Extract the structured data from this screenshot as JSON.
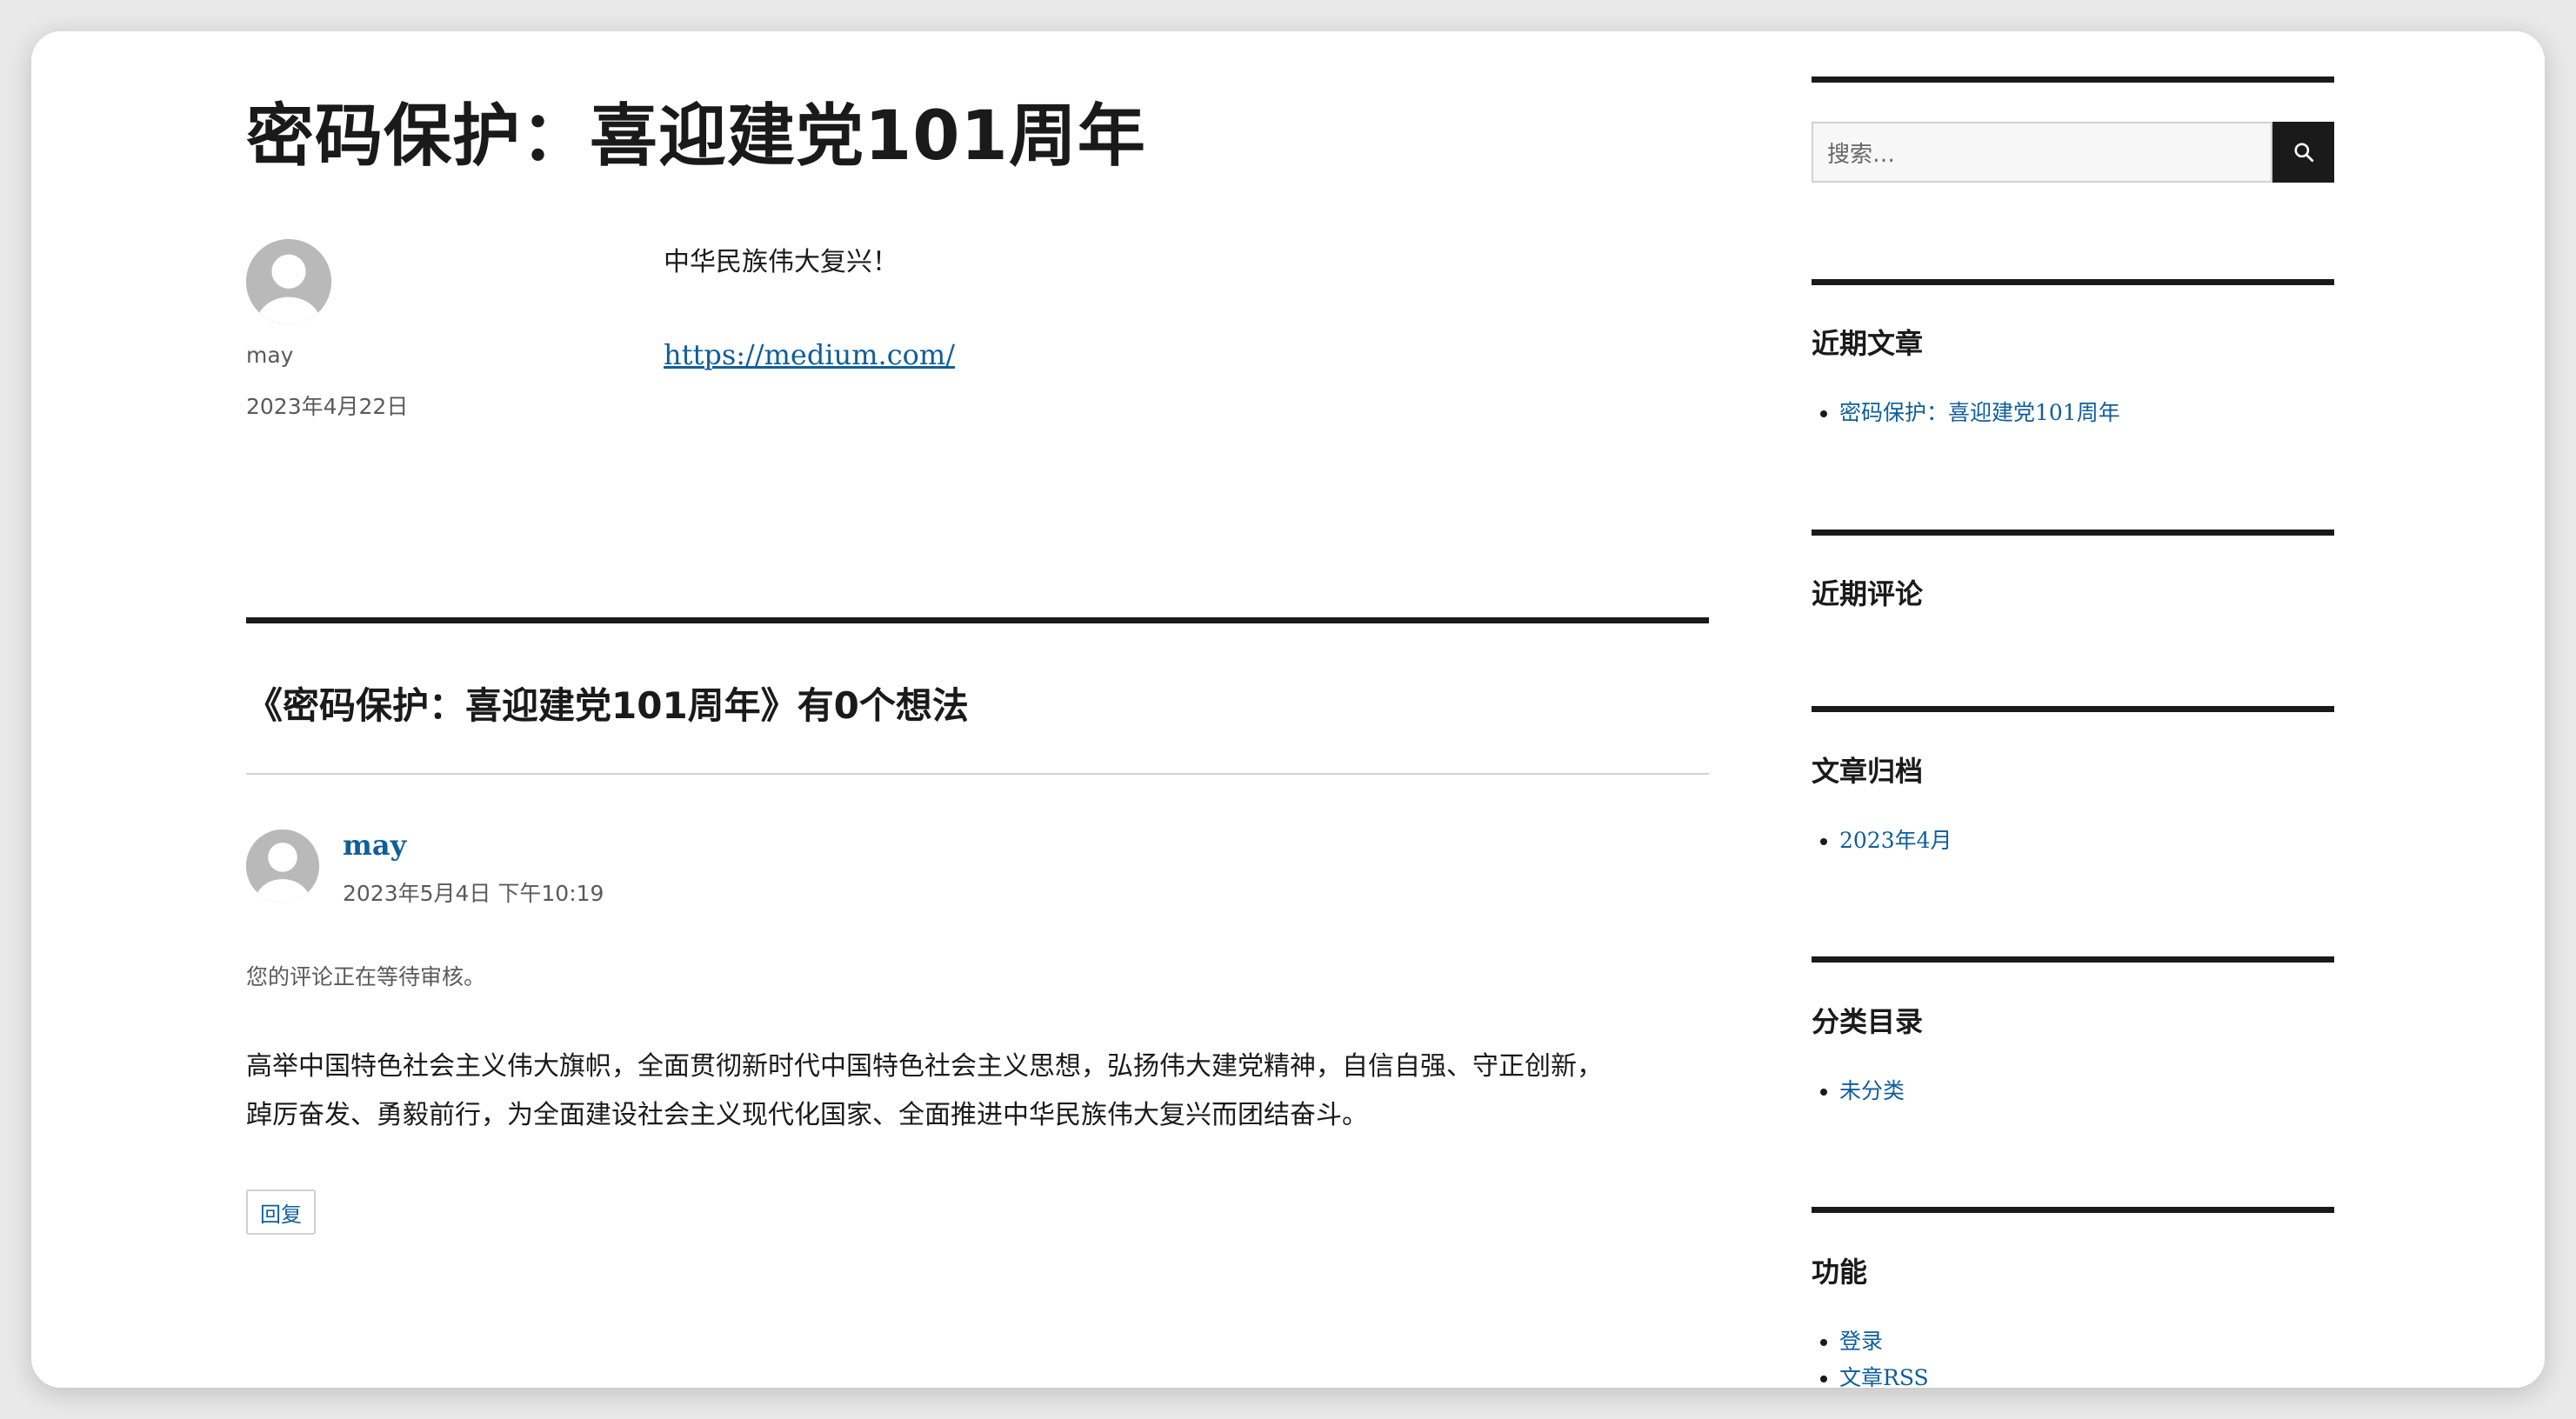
{
  "post": {
    "title": "密码保护：喜迎建党101周年",
    "author": "may",
    "date": "2023年4月22日",
    "content_line": "中华民族伟大复兴！",
    "link_text": "https://medium.com/"
  },
  "comments": {
    "title": "《密码保护：喜迎建党101周年》有0个想法",
    "items": [
      {
        "author": "may",
        "date": "2023年5月4日 下午10:19",
        "moderation_note": "您的评论正在等待审核。",
        "text_line1": "高举中国特色社会主义伟大旗帜，全面贯彻新时代中国特色社会主义思想，弘扬伟大建党精神，自信自强、守正创新，",
        "text_line2": "踔厉奋发、勇毅前行，为全面建设社会主义现代化国家、全面推进中华民族伟大复兴而团结奋斗。",
        "reply_label": "回复"
      }
    ]
  },
  "sidebar": {
    "search": {
      "placeholder": "搜索…",
      "icon": "search-icon"
    },
    "widgets": [
      {
        "title": "近期文章",
        "items": [
          "密码保护：喜迎建党101周年"
        ]
      },
      {
        "title": "近期评论",
        "items": []
      },
      {
        "title": "文章归档",
        "items": [
          "2023年4月"
        ]
      },
      {
        "title": "分类目录",
        "items": [
          "未分类"
        ]
      },
      {
        "title": "功能",
        "items": [
          "登录",
          "文章RSS"
        ]
      }
    ]
  },
  "colors": {
    "link": "#0f5e9c",
    "text": "#1a1a1a",
    "muted": "#5a5a5a",
    "rule": "#1a1a1a",
    "border": "#d1d1d1",
    "avatar": "#b9b9b9"
  }
}
